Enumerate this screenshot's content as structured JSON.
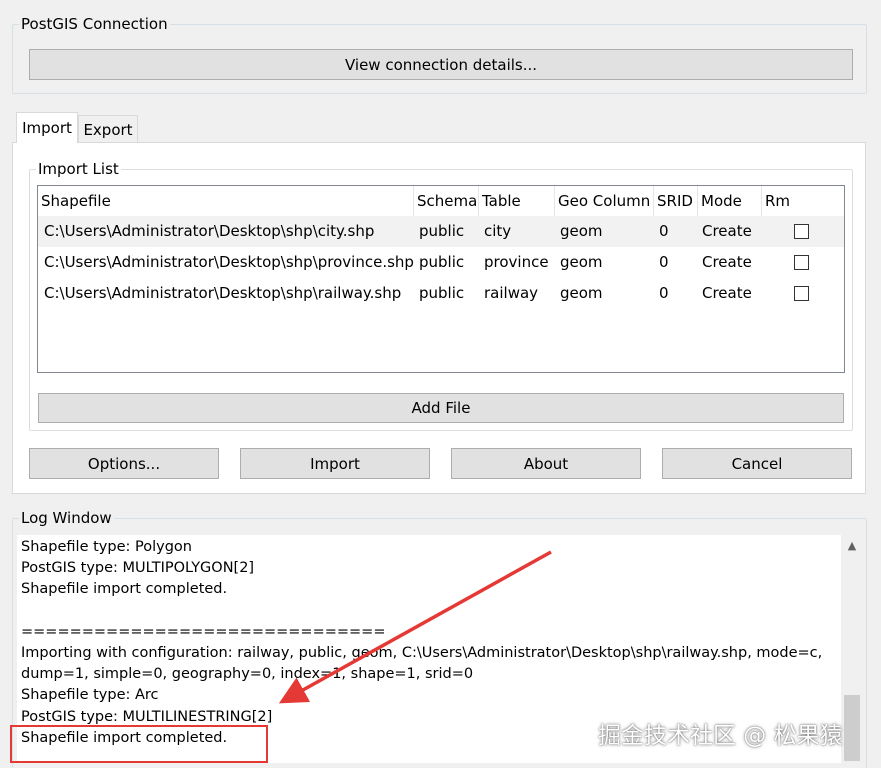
{
  "connection": {
    "group_title": "PostGIS Connection",
    "view_button": "View connection details..."
  },
  "tabs": [
    {
      "label": "Import",
      "active": true
    },
    {
      "label": "Export",
      "active": false
    }
  ],
  "import_list": {
    "group_title": "Import List",
    "columns": [
      "Shapefile",
      "Schema",
      "Table",
      "Geo Column",
      "SRID",
      "Mode",
      "Rm"
    ],
    "rows": [
      {
        "shapefile": "C:\\Users\\Administrator\\Desktop\\shp\\city.shp",
        "schema": "public",
        "table": "city",
        "geo_column": "geom",
        "srid": "0",
        "mode": "Create",
        "rm": false
      },
      {
        "shapefile": "C:\\Users\\Administrator\\Desktop\\shp\\province.shp",
        "schema": "public",
        "table": "province",
        "geo_column": "geom",
        "srid": "0",
        "mode": "Create",
        "rm": false
      },
      {
        "shapefile": "C:\\Users\\Administrator\\Desktop\\shp\\railway.shp",
        "schema": "public",
        "table": "railway",
        "geo_column": "geom",
        "srid": "0",
        "mode": "Create",
        "rm": false
      }
    ],
    "add_file_button": "Add File"
  },
  "actions": {
    "options": "Options...",
    "import": "Import",
    "about": "About",
    "cancel": "Cancel"
  },
  "log": {
    "group_title": "Log Window",
    "lines": [
      "Shapefile type: Polygon",
      "PostGIS type: MULTIPOLYGON[2]",
      "Shapefile import completed.",
      "",
      "==============================",
      "Importing with configuration: railway, public, geom, C:\\Users\\Administrator\\Desktop\\shp\\railway.shp, mode=c,",
      "dump=1, simple=0, geography=0, index=1, shape=1, srid=0",
      "Shapefile type: Arc",
      "PostGIS type: MULTILINESTRING[2]",
      "Shapefile import completed."
    ]
  },
  "annotation": {
    "color": "#e53935",
    "watermark": "掘金技术社区 @ 松果猿"
  },
  "icons": {
    "scroll_up": "chevron-up-icon"
  }
}
